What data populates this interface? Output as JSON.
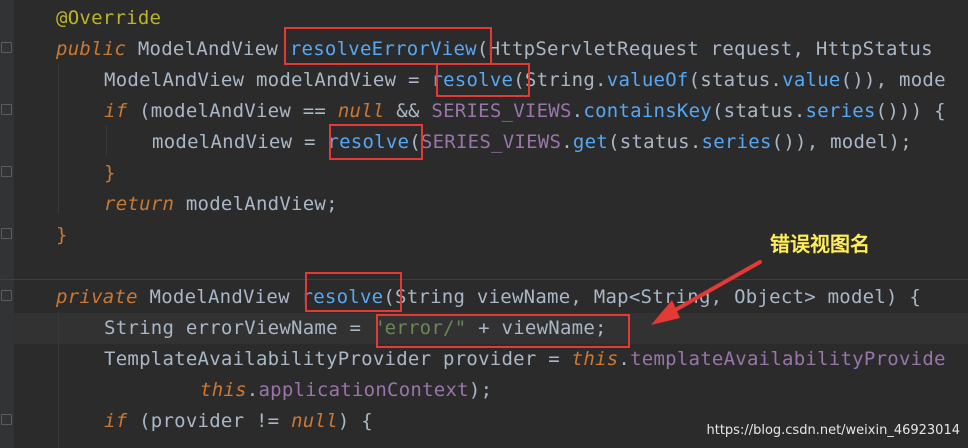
{
  "lines": {
    "l1": {
      "annotation": "@Override"
    },
    "l2": {
      "kw": "public",
      "rtype": "ModelAndView",
      "method": "resolveErrorView",
      "p1type": "HttpServletRequest",
      "p1": "request",
      "p2type": "HttpStatus"
    },
    "l3": {
      "type": "ModelAndView",
      "var": "modelAndView",
      "op": "=",
      "call": "resolve",
      "rest1": "String",
      "valueOf": "valueOf",
      "rest2": "status",
      "value": "value",
      "rest3": "()), ",
      "tail": "mode"
    },
    "l4": {
      "kw": "if",
      "cond1": "(modelAndView ==",
      "null": "null",
      "cond2": "&&",
      "constname": "SERIES_VIEWS",
      "contains": "containsKey",
      "status": "status",
      "series": "series",
      "end": "())) {"
    },
    "l5": {
      "var": "modelAndView",
      "op": "=",
      "call": "resolve",
      "constname": "SERIES_VIEWS",
      "get": "get",
      "status": "status",
      "series": "series",
      "end": "()), model);"
    },
    "l6": {
      "brace": "}"
    },
    "l7": {
      "kw": "return",
      "rest": "modelAndView;"
    },
    "l8": {
      "brace": "}"
    },
    "l9": {
      "kw": "private",
      "rtype": "ModelAndView",
      "method": "resolve",
      "p1type": "String",
      "p1": "viewName",
      "p2type": "Map<String, Object>",
      "p2": "model",
      "end": ") {"
    },
    "l10": {
      "type": "String",
      "var": "errorViewName",
      "op": "=",
      "str": "\"error/\"",
      "plus": "+",
      "rest": "viewName;"
    },
    "l11": {
      "type": "TemplateAvailabilityProvider",
      "var": "provider",
      "op": "=",
      "this": "this",
      "field": "templateAvailabilityProvide"
    },
    "l12": {
      "this": "this",
      "field": "applicationContext",
      "end": ");"
    },
    "l13": {
      "kw": "if",
      "cond": "(provider !=",
      "null": "null",
      "end": ") {"
    }
  },
  "annotation_note": "错误视图名",
  "watermark": "https://blog.csdn.net/weixin_46923014"
}
